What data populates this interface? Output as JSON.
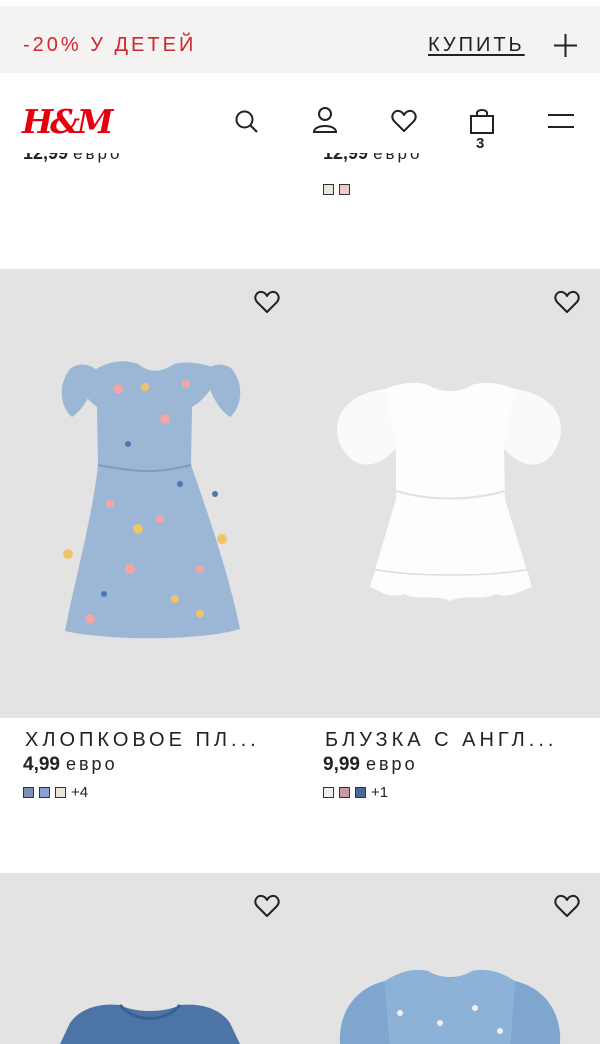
{
  "promo": {
    "text": "-20% У ДЕТЕЙ",
    "buy_label": "КУПИТЬ"
  },
  "header": {
    "logo": "H&M",
    "cart_count": "3"
  },
  "previous_row": [
    {
      "price": "12,99",
      "currency": "евро"
    },
    {
      "price": "12,99",
      "currency": "евро",
      "swatches": [
        "#e8e6dc",
        "#f2c9c6"
      ]
    }
  ],
  "products": [
    {
      "name": "ХЛОПКОВОЕ ПЛ...",
      "price": "4,99",
      "currency": "евро",
      "swatches": [
        "#7e8fb8",
        "#8aa0d8",
        "#e9e6dc"
      ],
      "more_colors": "+4"
    },
    {
      "name": "БЛУЗКА С АНГЛ...",
      "price": "9,99",
      "currency": "евро",
      "swatches": [
        "#efefec",
        "#c99aa0",
        "#4a6a94"
      ],
      "more_colors": "+1"
    }
  ],
  "icons": [
    "plus-icon",
    "search-icon",
    "account-icon",
    "heart-icon",
    "cart-icon",
    "menu-icon"
  ]
}
